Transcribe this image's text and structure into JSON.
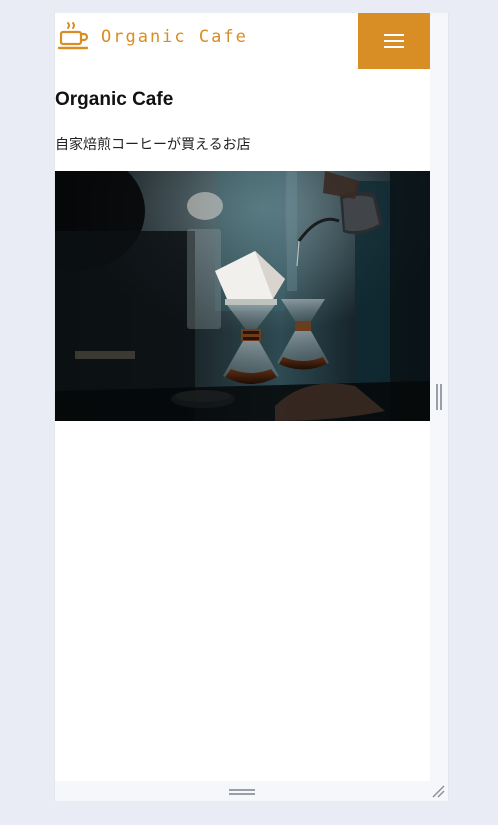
{
  "header": {
    "logo_text": "Organic Cafe",
    "logo_icon": "coffee-cup-icon",
    "menu_icon": "hamburger-menu-icon"
  },
  "main": {
    "title": "Organic Cafe",
    "tagline": "自家焙煎コーヒーが買えるお店"
  },
  "hero": {
    "image": "pour-over-coffee-photo"
  },
  "colors": {
    "accent": "#d88d25",
    "background": "#e9ecf4",
    "page": "#ffffff"
  }
}
